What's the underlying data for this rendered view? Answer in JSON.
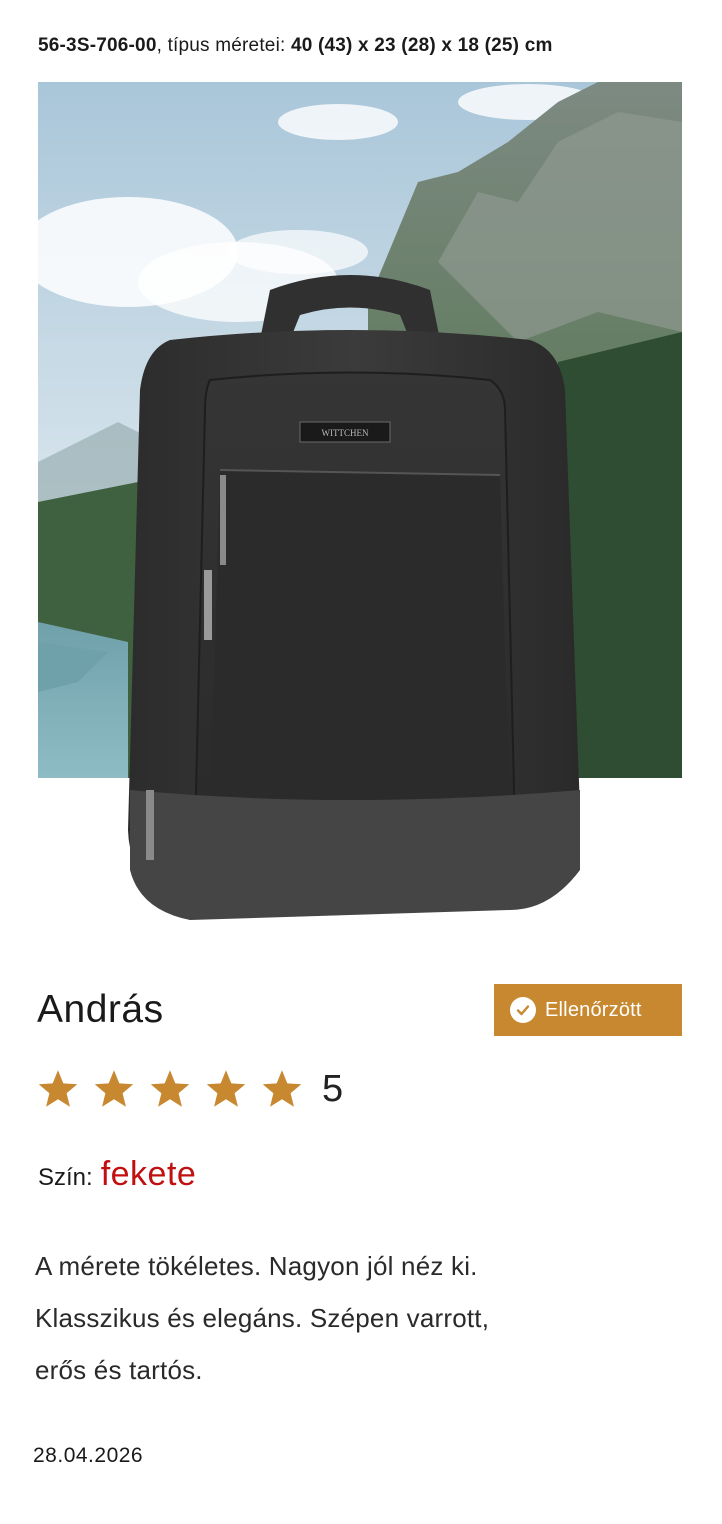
{
  "product": {
    "code": "56-3S-706-00",
    "separator": ",",
    "dims_label": "típus méretei:",
    "dims_value": "40 (43) x 23 (28) x 18 (25)",
    "dims_unit": "cm",
    "image_icon": "backpack-photo",
    "brand_tag": "WITTCHEN"
  },
  "review": {
    "author": "András",
    "verified_label": "Ellenőrzött",
    "verified_icon": "check-circle-icon",
    "rating": 5,
    "rating_max": 5,
    "rating_text": "5",
    "color_label": "Szín:",
    "color_value": "fekete",
    "text_lines": [
      "A mérete tökéletes. Nagyon jól néz ki.",
      "Klasszikus és elegáns. Szépen varrott,",
      "erős és tartós."
    ],
    "date": "28.04.2026"
  },
  "colors": {
    "accent": "#c8882f",
    "star": "#c8882f",
    "color_value": "#c01010"
  }
}
